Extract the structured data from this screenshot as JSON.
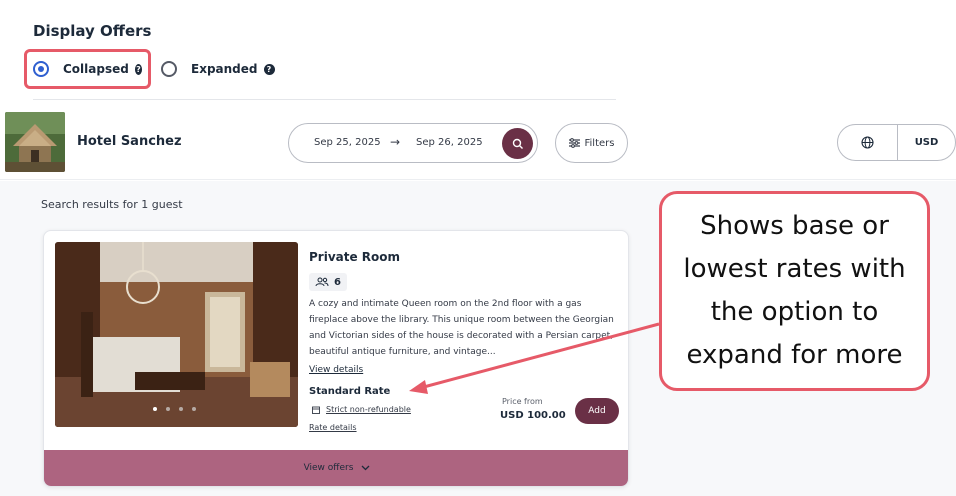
{
  "display_offers": {
    "title": "Display Offers",
    "options": [
      {
        "label": "Collapsed",
        "selected": true
      },
      {
        "label": "Expanded",
        "selected": false
      }
    ],
    "help_glyph": "?"
  },
  "header": {
    "hotel_name": "Hotel Sanchez",
    "check_in": "Sep 25, 2025",
    "arrow": "→",
    "check_out": "Sep 26, 2025",
    "filters_label": "Filters",
    "currency": "USD"
  },
  "results": {
    "summary": "Search results for 1 guest"
  },
  "room": {
    "name": "Private Room",
    "guests": "6",
    "description": "A cozy and intimate Queen room on the 2nd floor with a gas fireplace above the library. This unique room between the Georgian and Victorian sides of the house is decorated with a Persian carpet, beautiful antique furniture, and vintage...",
    "view_details": "View details",
    "rate_name": "Standard Rate",
    "refund_policy": "Strict non-refundable",
    "rate_details": "Rate details",
    "price_label": "Price from",
    "price": "USD 100.00",
    "add_label": "Add",
    "view_offers_label": "View offers"
  },
  "callout": {
    "text": "Shows base or lowest rates with the option to expand for more"
  },
  "colors": {
    "accent": "#6a3046",
    "offers_bar": "#ad6480",
    "highlight": "#e65a68",
    "radio_selected": "#2f5fd0"
  }
}
